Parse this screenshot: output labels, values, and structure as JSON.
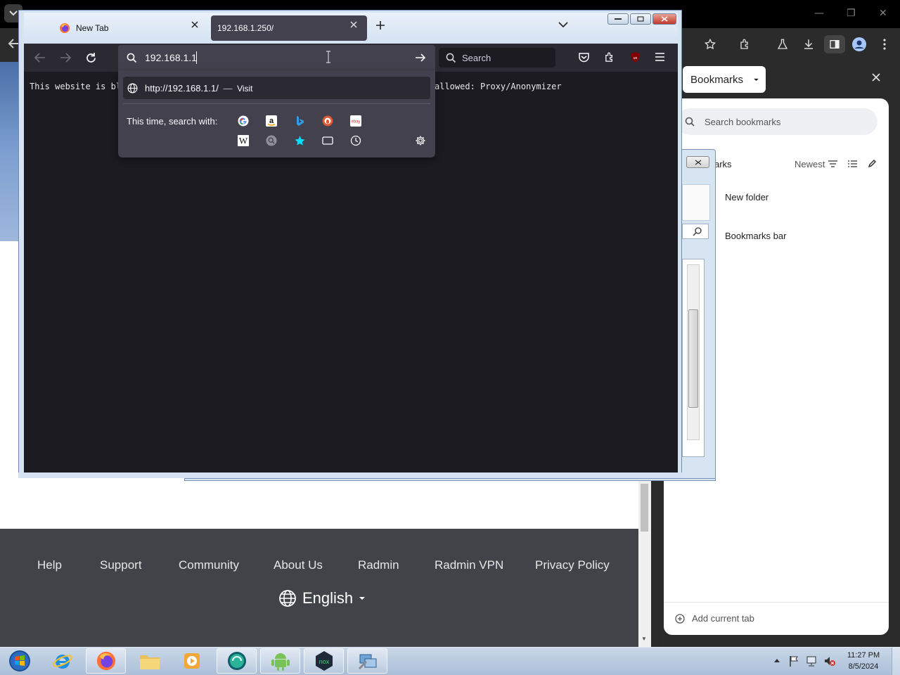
{
  "chrome": {
    "minimize": "—",
    "restore": "❐",
    "close": "✕"
  },
  "bookmarks": {
    "panel_title": "Bookmarks",
    "search_placeholder": "Search bookmarks",
    "header_partial": "arks",
    "sort_label": "Newest",
    "items": [
      "New folder",
      "Bookmarks bar"
    ],
    "add_current_tab": "Add current tab"
  },
  "footer": {
    "links": [
      "Help",
      "Support",
      "Community",
      "About Us",
      "Radmin",
      "Radmin VPN",
      "Privacy Policy"
    ],
    "language": "English"
  },
  "firefox": {
    "tabs": [
      {
        "title": "New Tab"
      },
      {
        "title": "192.168.1.250/"
      }
    ],
    "url_input": "192.168.1.1",
    "suggestion_url": "http://192.168.1.1/",
    "suggestion_sep": "—",
    "suggestion_action": "Visit",
    "search_with_label": "This time, search with:",
    "search_placeholder": "Search",
    "blocked_text_left": "This website is bl",
    "blocked_text_right": "allowed: Proxy/Anonymizer",
    "engines_row1": [
      "google-icon",
      "amazon-icon",
      "bing-icon",
      "duckduckgo-icon",
      "ebay-icon"
    ],
    "engines_row2": [
      "wikipedia-icon",
      "tab-search-icon",
      "bookmarks-star-icon",
      "tabs-icon",
      "history-icon"
    ],
    "engine_glyphs": {
      "ebay": "ebay",
      "wikipedia": "W"
    }
  },
  "taskbar": {
    "time": "11:27 PM",
    "date": "8/5/2024",
    "apps": [
      "start",
      "internet-explorer",
      "firefox",
      "file-explorer",
      "media-player",
      "radmin-vpn",
      "android-emulator",
      "nox-player",
      "network-tool"
    ]
  },
  "colors": {
    "ff_dark": "#2b2a33",
    "ff_field": "#42414d",
    "footer_bg": "#404448",
    "taskbar": "#b9cce3"
  }
}
